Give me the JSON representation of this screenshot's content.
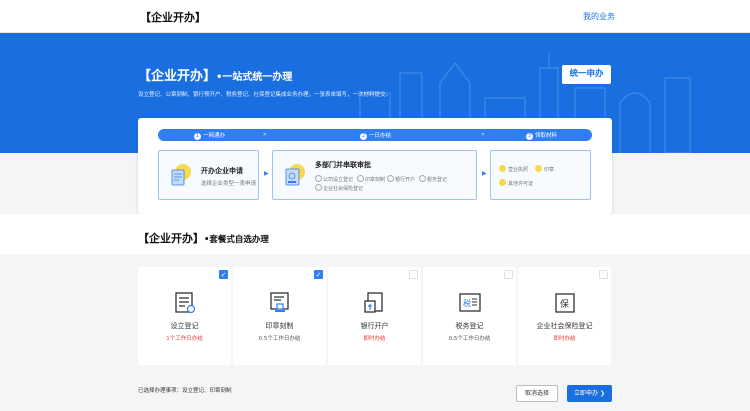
{
  "header": {
    "brand": "【企业开办】",
    "my_business": "我的业务"
  },
  "hero": {
    "title": "【企业开办】",
    "title_suffix": "•一站式统一办理",
    "desc": "设立登记、公章刻制、银行预开户、税务登记、社保登记集成业务办理，一张表单填写，一次材料提交。",
    "apply_button": "统一申办"
  },
  "flow": {
    "steps": [
      {
        "num": "1",
        "label": "一网通办"
      },
      {
        "num": "2",
        "label": "一日办结"
      },
      {
        "num": "3",
        "label": "领取材料"
      }
    ],
    "box1": {
      "title": "开办企业申请",
      "sub": "选择企业类型一表申请"
    },
    "box2": {
      "title": "多部门并串联审批",
      "tags": [
        "公司设立登记",
        "印章刻制",
        "银行开户",
        "税务登记",
        "企业社会保险登记"
      ]
    },
    "box3": {
      "items": [
        "营业执照",
        "印章",
        "其他许可证"
      ]
    }
  },
  "section2": {
    "title": "【企业开办】",
    "title_suffix": "•套餐式自选办理",
    "options": [
      {
        "name": "设立登记",
        "time": "1个工作日办结",
        "checked": true,
        "icon": "form-icon"
      },
      {
        "name": "印章刻制",
        "time": "0.5个工作日办结",
        "checked": true,
        "icon": "seal-icon"
      },
      {
        "name": "银行开户",
        "time": "即时办结",
        "checked": false,
        "icon": "bank-card-icon"
      },
      {
        "name": "税务登记",
        "time": "0.5个工作日办结",
        "checked": false,
        "icon": "tax-icon"
      },
      {
        "name": "企业社会保险登记",
        "time": "即时办结",
        "checked": false,
        "icon": "insurance-icon"
      }
    ],
    "selected_text": "已选择办理事项：设立登记、印章刻制",
    "cancel": "取消选择",
    "apply_now": "立即申办 ❯"
  },
  "colors": {
    "primary": "#1a6fe0",
    "accent_red": "#e53935"
  }
}
